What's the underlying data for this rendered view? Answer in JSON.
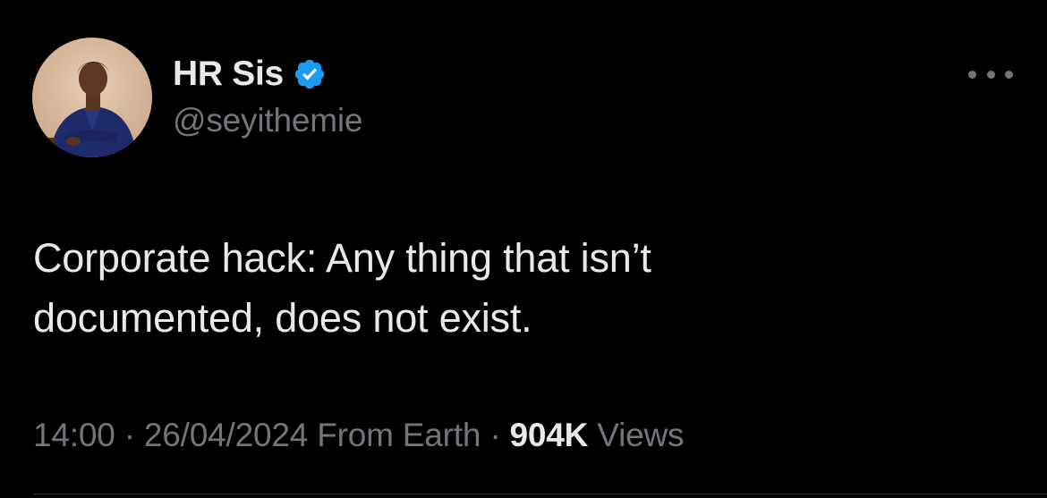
{
  "author": {
    "display_name": "HR Sis",
    "handle": "@seyithemie",
    "verified": true,
    "verified_badge_color": "#1d9bf0"
  },
  "tweet": {
    "text": "Corporate hack: Any thing that isn’t\ndocumented, does not exist.",
    "time": "14:00",
    "separator": "·",
    "date": "26/04/2024",
    "source": "From Earth",
    "views_count": "904K",
    "views_label": "Views"
  },
  "icons": {
    "more": "more-options-icon",
    "verified": "verified-badge-icon"
  },
  "colors": {
    "background": "#000000",
    "primary_text": "#e7e9ea",
    "secondary_text": "#71767b",
    "divider": "#2f3336"
  }
}
